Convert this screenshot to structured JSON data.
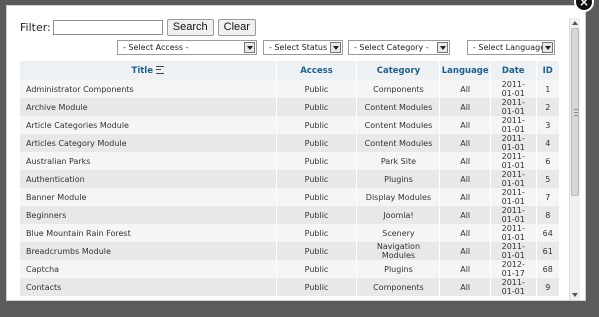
{
  "dialog": {
    "close_glyph": "×"
  },
  "filter": {
    "label": "Filter:",
    "value": "",
    "placeholder": "",
    "search_label": "Search",
    "clear_label": "Clear"
  },
  "selects": {
    "access": "- Select Access -",
    "status": "- Select Status -",
    "category": "- Select Category -",
    "language": "- Select Language -"
  },
  "table": {
    "headers": [
      "Title",
      "Access",
      "Category",
      "Language",
      "Date",
      "ID"
    ],
    "rows": [
      [
        "Administrator Components",
        "Public",
        "Components",
        "All",
        "2011-01-01",
        "1"
      ],
      [
        "Archive Module",
        "Public",
        "Content Modules",
        "All",
        "2011-01-01",
        "2"
      ],
      [
        "Article Categories Module",
        "Public",
        "Content Modules",
        "All",
        "2011-01-01",
        "3"
      ],
      [
        "Articles Category Module",
        "Public",
        "Content Modules",
        "All",
        "2011-01-01",
        "4"
      ],
      [
        "Australian Parks",
        "Public",
        "Park Site",
        "All",
        "2011-01-01",
        "6"
      ],
      [
        "Authentication",
        "Public",
        "Plugins",
        "All",
        "2011-01-01",
        "5"
      ],
      [
        "Banner Module",
        "Public",
        "Display Modules",
        "All",
        "2011-01-01",
        "7"
      ],
      [
        "Beginners",
        "Public",
        "Joomla!",
        "All",
        "2011-01-01",
        "8"
      ],
      [
        "Blue Mountain Rain Forest",
        "Public",
        "Scenery",
        "All",
        "2011-01-01",
        "64"
      ],
      [
        "Breadcrumbs Module",
        "Public",
        "Navigation Modules",
        "All",
        "2011-01-01",
        "61"
      ],
      [
        "Captcha",
        "Public",
        "Plugins",
        "All",
        "2012-01-17",
        "68"
      ],
      [
        "Contacts",
        "Public",
        "Components",
        "All",
        "2011-01-01",
        "9"
      ]
    ]
  }
}
